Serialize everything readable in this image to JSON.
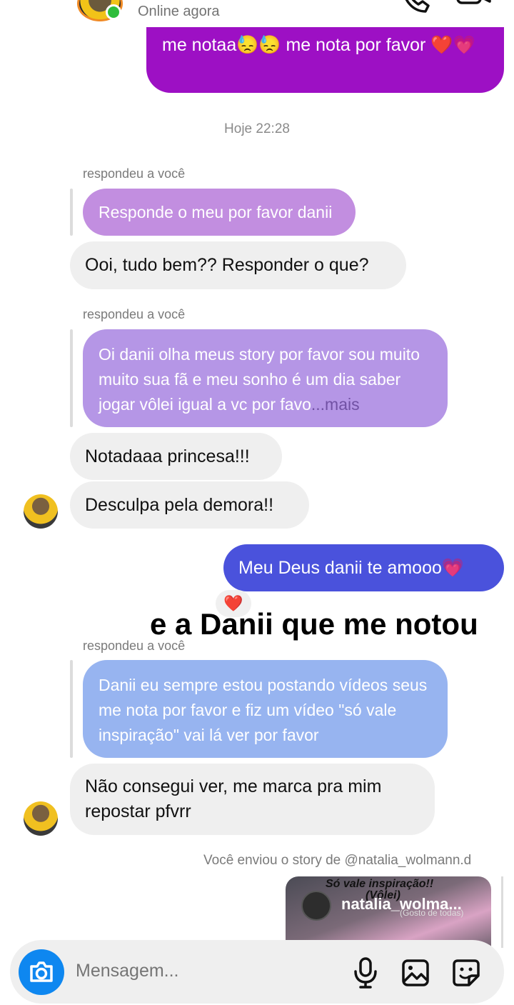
{
  "header": {
    "status": "Online agora",
    "icons": [
      "back-arrow-icon",
      "phone-icon",
      "video-icon"
    ]
  },
  "messages": {
    "sent_top": "me notaa😓😓 me nota por favor ❤️💗",
    "timestamp": "Hoje 22:28",
    "replied_label": "respondeu a você",
    "quote1": "Responde o meu por favor danii",
    "recv1": "Ooi, tudo bem?? Responder o que?",
    "quote2_text": "Oi danii olha meus story por favor sou muito muito sua fã e meu sonho é um dia saber jogar vôlei igual a vc por favo",
    "quote2_more": "...mais",
    "recv2": "Notadaaa princesa!!!",
    "recv3": "Desculpa pela demora!!",
    "sent_blue": "Meu Deus danii te amooo💗",
    "reaction": "❤️",
    "overlay": "e a Danii que me notou",
    "quote3": "Danii eu sempre estou postando vídeos seus me nota por favor e fiz um vídeo \"só vale inspiração\" vai lá ver por favor",
    "recv4": "Não consegui ver, me marca pra mim repostar pfvrr",
    "story_label": "Você enviou o story de @natalia_wolmann.d",
    "story_user": "natalia_wolma...",
    "story_caption1": "Só vale inspiração!!",
    "story_caption2": "(Vôlei)",
    "story_caption3": "(Gosto de todas)"
  },
  "composer": {
    "placeholder": "Mensagem..."
  },
  "colors": {
    "sent_purple": "#9d10c4",
    "sent_blue": "#4a52dc",
    "received": "#efefef",
    "camera": "#0e87f0"
  }
}
